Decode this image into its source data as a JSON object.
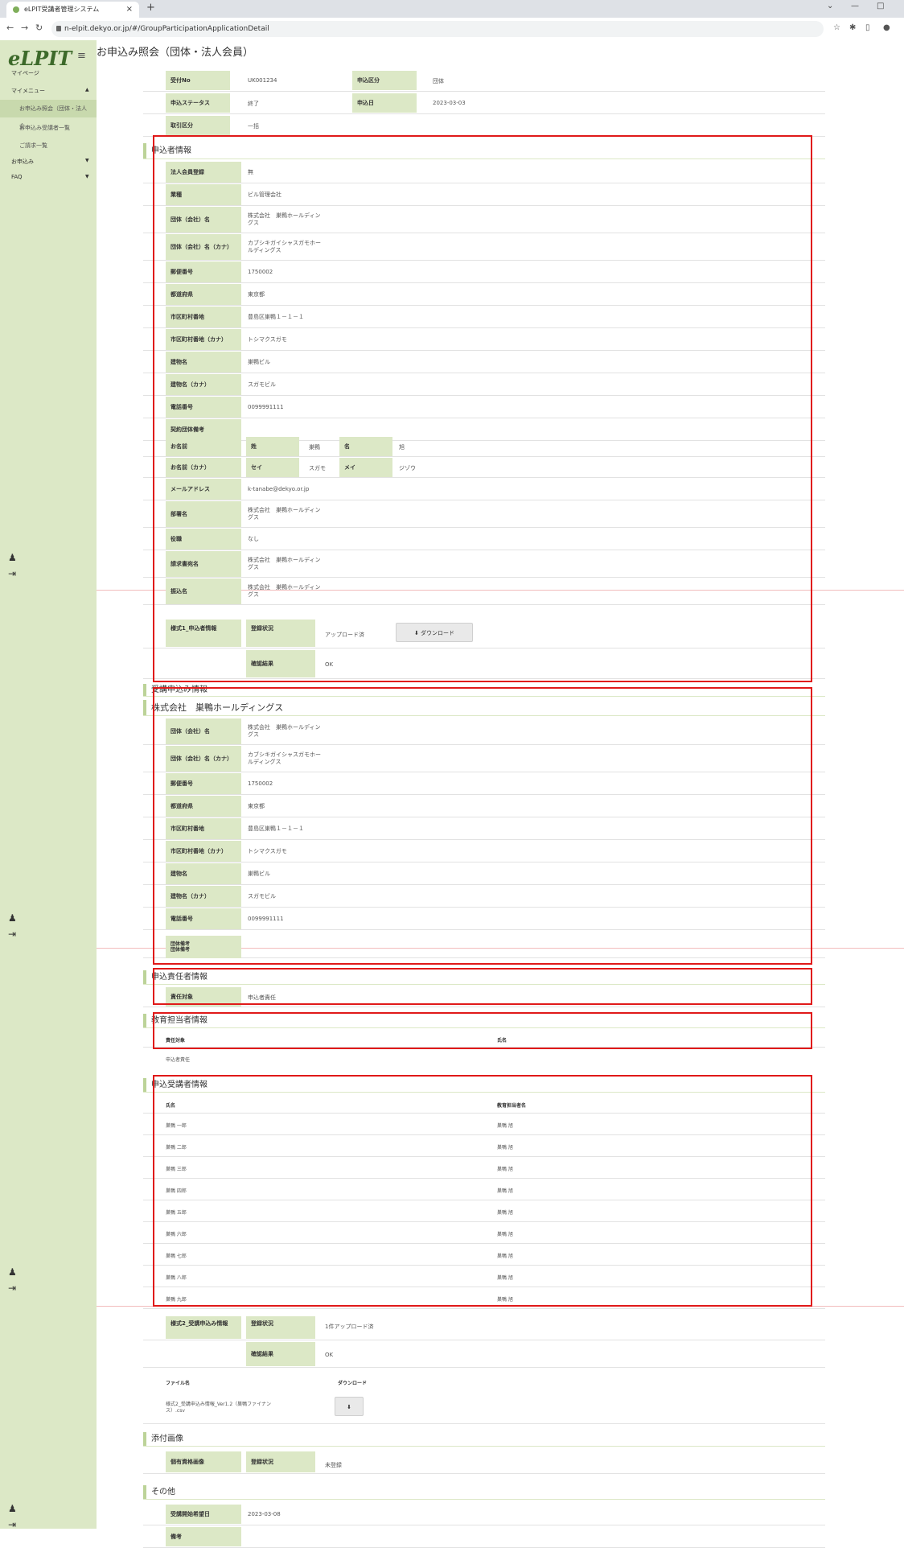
{
  "browser": {
    "tab_title": "eLPIT受講者管理システム",
    "url": "n-elpit.dekyo.or.jp/#/GroupParticipationApplicationDetail",
    "win_min": "—",
    "win_max": "□",
    "chevron": "⌄"
  },
  "sidebar": {
    "logo": "eLPIT",
    "logo_sub": "マイページ",
    "menu": "マイメニュー",
    "items": [
      "お申込み照会（団体・法人企...",
      "お申込み受講者一覧",
      "ご請求一覧"
    ],
    "apply": "お申込み",
    "faq": "FAQ"
  },
  "page": {
    "title": "お申込み照会（団体・法人会員）"
  },
  "summary": {
    "uketsuke_no_label": "受付No",
    "uketsuke_no": "UK001234",
    "kubun_label": "申込区分",
    "kubun": "団体",
    "status_label": "申込ステータス",
    "status": "終了",
    "date_label": "申込日",
    "date": "2023-03-03",
    "torihiki_label": "取引区分",
    "torihiki": "一括"
  },
  "applicant": {
    "title": "申込者情報",
    "rows": [
      {
        "label": "法人会員登録",
        "value": "無"
      },
      {
        "label": "業種",
        "value": "ビル管理会社"
      },
      {
        "label": "団体（会社）名",
        "value": "株式会社　巣鴨ホールディン\nグス"
      },
      {
        "label": "団体（会社）名（カナ）",
        "value": "カブシキガイシャスガモホー\nルディングス"
      },
      {
        "label": "郵便番号",
        "value": "1750002"
      },
      {
        "label": "都道府県",
        "value": "東京都"
      },
      {
        "label": "市区町村番地",
        "value": "豊島区巣鴨１－１－１"
      },
      {
        "label": "市区町村番地（カナ）",
        "value": "トシマクスガモ"
      },
      {
        "label": "建物名",
        "value": "巣鴨ビル"
      },
      {
        "label": "建物名（カナ）",
        "value": "スガモビル"
      },
      {
        "label": "電話番号",
        "value": "0099991111"
      },
      {
        "label": "契約団体備考",
        "value": ""
      }
    ],
    "name_label": "お名前",
    "sei_label": "姓",
    "sei": "巣鴨",
    "mei_label": "名",
    "mei": "旭",
    "kana_label": "お名前（カナ）",
    "seikana_label": "セイ",
    "seikana": "スガモ",
    "meikana_label": "メイ",
    "meikana": "ジゾウ",
    "rows2": [
      {
        "label": "メールアドレス",
        "value": "k-tanabe@dekyo.or.jp"
      },
      {
        "label": "部署名",
        "value": "株式会社　巣鴨ホールディン\nグス"
      },
      {
        "label": "役職",
        "value": "なし"
      },
      {
        "label": "請求書宛名",
        "value": "株式会社　巣鴨ホールディン\nグス"
      },
      {
        "label": "振込名",
        "value": "株式会社　巣鴨ホールディン\nグス"
      }
    ],
    "form1_label": "様式1_申込者情報",
    "upload_label": "登録状況",
    "upload_value": "アップロード済",
    "download_btn": "ダウンロード",
    "check_label": "確認結果",
    "check_value": "OK"
  },
  "trainee_app": {
    "title": "受講申込み情報",
    "company": "株式会社　巣鴨ホールディングス",
    "rows": [
      {
        "label": "団体（会社）名",
        "value": "株式会社　巣鴨ホールディン\nグス"
      },
      {
        "label": "団体（会社）名（カナ）",
        "value": "カブシキガイシャスガモホー\nルディングス"
      },
      {
        "label": "郵便番号",
        "value": "1750002"
      },
      {
        "label": "都道府県",
        "value": "東京都"
      },
      {
        "label": "市区町村番地",
        "value": "豊島区巣鴨１－１－１"
      },
      {
        "label": "市区町村番地（カナ）",
        "value": "トシマクスガモ"
      },
      {
        "label": "建物名",
        "value": "巣鴨ビル"
      },
      {
        "label": "建物名（カナ）",
        "value": "スガモビル"
      },
      {
        "label": "電話番号",
        "value": "0099991111"
      }
    ],
    "last_label": "団体備考\n団体備考"
  },
  "responsible": {
    "title": "申込責任者情報",
    "label": "責任対象",
    "value": "申込者責任"
  },
  "education": {
    "title": "教育担当者情報",
    "col1": "責任対象",
    "col2": "氏名",
    "row1": "申込者責任"
  },
  "trainees": {
    "title": "申込受講者情報",
    "col1": "氏名",
    "col2": "教育担当者名",
    "rows": [
      {
        "name": "巣鴨 一郎",
        "teacher": "巣鴨 旭"
      },
      {
        "name": "巣鴨 二郎",
        "teacher": "巣鴨 旭"
      },
      {
        "name": "巣鴨 三郎",
        "teacher": "巣鴨 旭"
      },
      {
        "name": "巣鴨 四郎",
        "teacher": "巣鴨 旭"
      },
      {
        "name": "巣鴨 五郎",
        "teacher": "巣鴨 旭"
      },
      {
        "name": "巣鴨 六郎",
        "teacher": "巣鴨 旭"
      },
      {
        "name": "巣鴨 七郎",
        "teacher": "巣鴨 旭"
      },
      {
        "name": "巣鴨 八郎",
        "teacher": "巣鴨 旭"
      },
      {
        "name": "巣鴨 九郎",
        "teacher": "巣鴨 旭"
      }
    ]
  },
  "form2": {
    "label": "様式2_受講申込み情報",
    "upload_label": "登録状況",
    "upload_value": "1件アップロード済",
    "check_label": "確認結果",
    "check_value": "OK",
    "file_col": "ファイル名",
    "dl_col": "ダウンロード",
    "file_name": "様式2_受講申込み情報_Ver1.2（巣鴨ファイナン\nス）.csv"
  },
  "attach": {
    "title": "添付画像",
    "label": "個有資格画像",
    "upload_label": "登録状況",
    "upload_value": "未登録"
  },
  "other": {
    "title": "その他",
    "label": "受講開始希望日",
    "value": "2023-03-08",
    "note_label": "備考"
  },
  "colors": {
    "accent": "#dce8c6",
    "label_bg": "#dce8c6",
    "red": "#e01919"
  }
}
